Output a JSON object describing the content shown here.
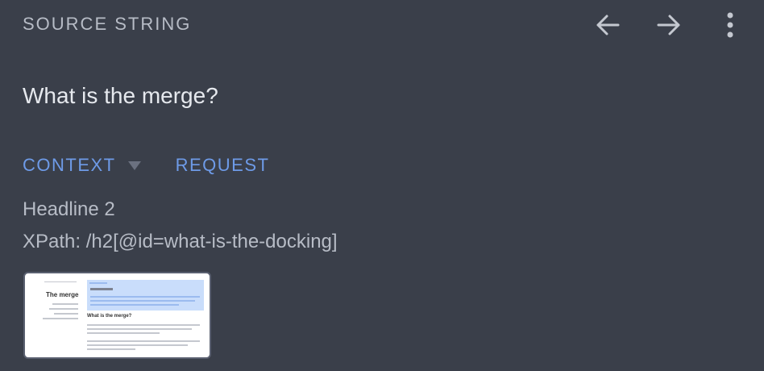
{
  "header": {
    "title": "SOURCE STRING",
    "icons": [
      "arrow-left-icon",
      "arrow-right-icon",
      "more-vert-icon"
    ]
  },
  "source": {
    "text": "What is the merge?"
  },
  "tabs": [
    {
      "label": "CONTEXT",
      "active": true
    },
    {
      "label": "REQUEST",
      "active": false
    }
  ],
  "context": {
    "type": "Headline 2",
    "xpath": "XPath: /h2[@id=what-is-the-docking]"
  },
  "thumbnail": {
    "title": "The merge",
    "heading": "What is the merge?"
  },
  "colors": {
    "background": "#3a3f4a",
    "accent": "#6e9be8",
    "text_primary": "#e6e9ee",
    "text_secondary": "#b7bcc6"
  }
}
